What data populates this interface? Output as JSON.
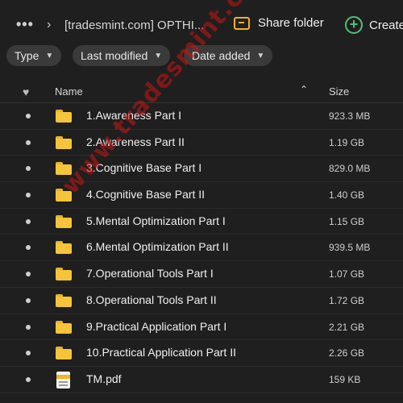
{
  "topbar": {
    "more_label": "•••",
    "chevron": "›",
    "breadcrumb": "[tradesmint.com] OPTHI...",
    "share_label": "Share folder",
    "create_label": "Create"
  },
  "filters": [
    {
      "label": "Type"
    },
    {
      "label": "Last modified"
    },
    {
      "label": "Date added"
    }
  ],
  "header": {
    "name_label": "Name",
    "size_label": "Size",
    "sort_icon": "sort-ascending-icon"
  },
  "files": [
    {
      "name": "1.Awareness Part I",
      "size": "923.3 MB",
      "type": "folder"
    },
    {
      "name": "2.Awareness Part II",
      "size": "1.19 GB",
      "type": "folder"
    },
    {
      "name": "3.Cognitive Base Part I",
      "size": "829.0 MB",
      "type": "folder"
    },
    {
      "name": "4.Cognitive Base Part II",
      "size": "1.40 GB",
      "type": "folder"
    },
    {
      "name": "5.Mental Optimization Part I",
      "size": "1.15 GB",
      "type": "folder"
    },
    {
      "name": "6.Mental Optimization Part II",
      "size": "939.5 MB",
      "type": "folder"
    },
    {
      "name": "7.Operational Tools Part I",
      "size": "1.07 GB",
      "type": "folder"
    },
    {
      "name": "8.Operational Tools Part II",
      "size": "1.72 GB",
      "type": "folder"
    },
    {
      "name": "9.Practical Application Part I",
      "size": "2.21 GB",
      "type": "folder"
    },
    {
      "name": "10.Practical Application Part II",
      "size": "2.26 GB",
      "type": "folder"
    },
    {
      "name": "TM.pdf",
      "size": "159 KB",
      "type": "pdf"
    }
  ],
  "watermark": "www.tradesmint.com",
  "colors": {
    "background": "#1f1f1f",
    "folder": "#f6c43a",
    "share_icon": "#f2b21a",
    "create_icon": "#4fc07a",
    "watermark": "#c81414"
  }
}
